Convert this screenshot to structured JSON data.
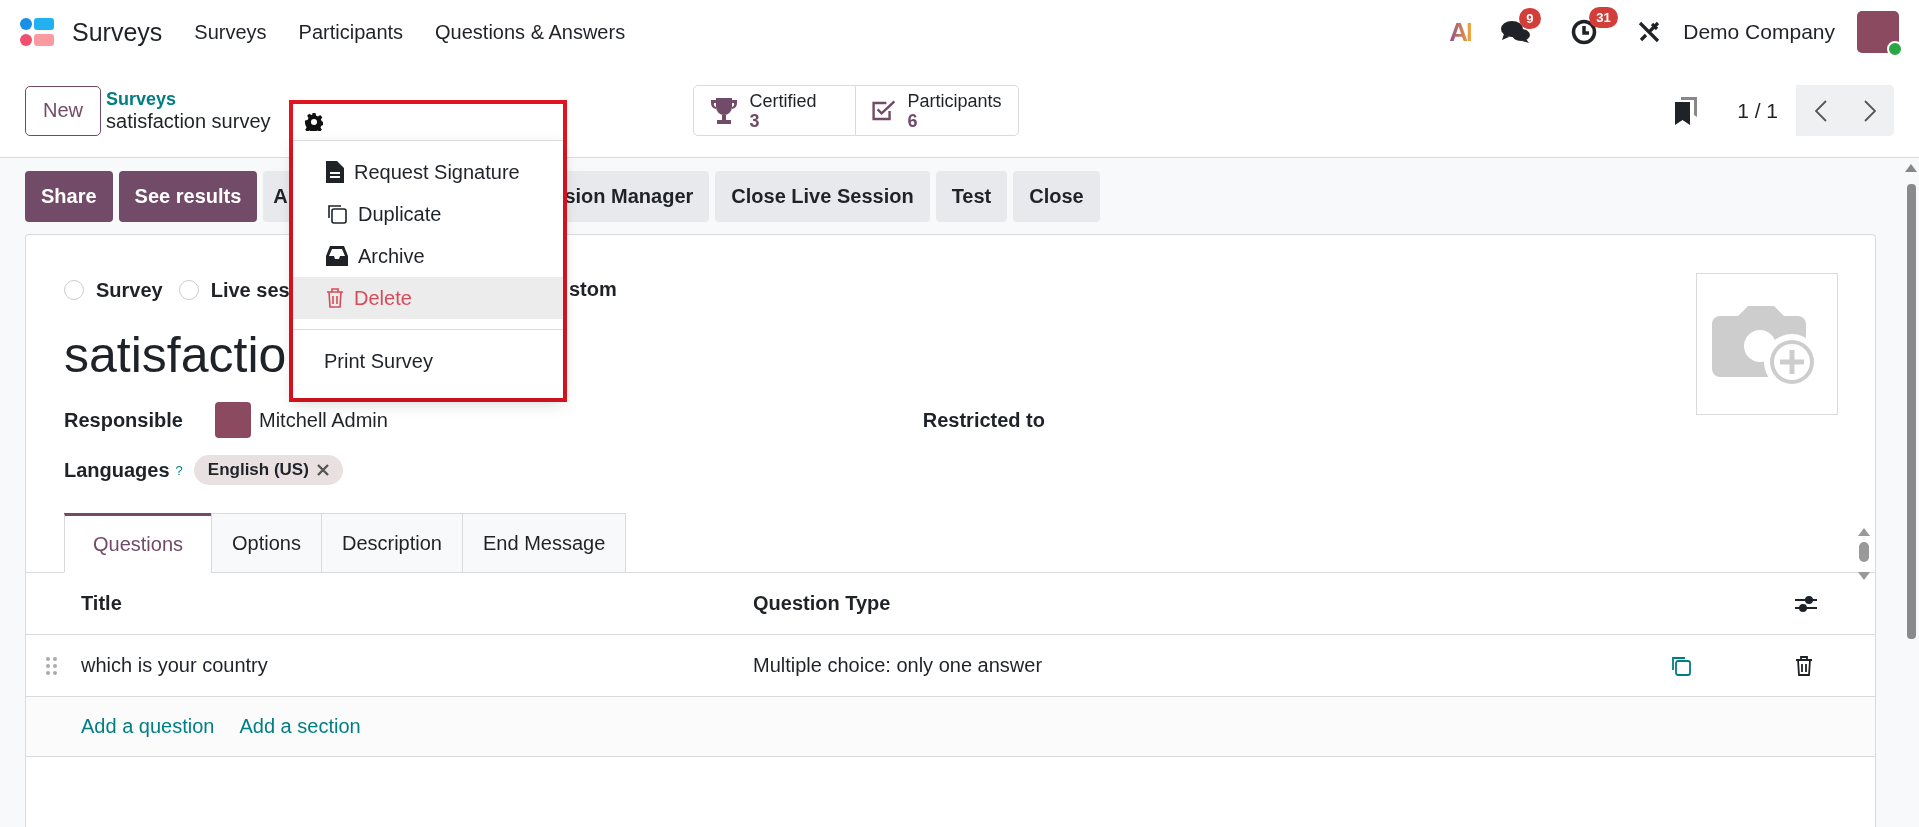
{
  "navbar": {
    "app_name": "Surveys",
    "menu": [
      "Surveys",
      "Participants",
      "Questions & Answers"
    ],
    "ai_label": "AI",
    "messages_badge": "9",
    "activities_badge": "31",
    "company": "Demo Company",
    "user_online": true
  },
  "control_panel": {
    "new_button": "New",
    "breadcrumb": "Surveys",
    "record_name": "satisfaction survey",
    "stat_buttons": [
      {
        "kind": "certified",
        "label": "Certified",
        "value": "3"
      },
      {
        "kind": "participants",
        "label": "Participants",
        "value": "6"
      }
    ],
    "pager": "1 / 1"
  },
  "action_menu": {
    "items": [
      {
        "kind": "signature",
        "label": "Request Signature",
        "highlighted": false
      },
      {
        "kind": "duplicate",
        "label": "Duplicate",
        "highlighted": false
      },
      {
        "kind": "archive",
        "label": "Archive",
        "highlighted": false
      },
      {
        "kind": "delete",
        "label": "Delete",
        "highlighted": true
      }
    ],
    "report_items": [
      "Print Survey"
    ]
  },
  "buttons": [
    {
      "kind": "primary",
      "label": "Share"
    },
    {
      "kind": "primary",
      "label": "See results"
    },
    {
      "kind": "covered-start",
      "label": "A"
    },
    {
      "kind": "covered-end",
      "label": "sion Manager"
    },
    {
      "kind": "secondary",
      "label": "Close Live Session"
    },
    {
      "kind": "secondary",
      "label": "Test"
    },
    {
      "kind": "secondary",
      "label": "Close"
    }
  ],
  "survey_type": [
    {
      "kind": "radio",
      "label": "Survey",
      "selected": false
    },
    {
      "kind": "radio",
      "label": "Live ses",
      "selected": false
    },
    {
      "kind": "covered",
      "label": "stom"
    }
  ],
  "title": "satisfactio",
  "responsible": {
    "label": "Responsible",
    "value": "Mitchell Admin"
  },
  "restricted_to": {
    "label": "Restricted to"
  },
  "languages": {
    "label": "Languages",
    "help": "?",
    "tags": [
      "English (US)"
    ]
  },
  "tabs": [
    {
      "label": "Questions",
      "selected": true
    },
    {
      "label": "Options",
      "selected": false
    },
    {
      "label": "Description",
      "selected": false
    },
    {
      "label": "End Message",
      "selected": false
    }
  ],
  "table": {
    "columns": [
      "Title",
      "Question Type"
    ],
    "rows": [
      {
        "title": "which is your country",
        "question_type": "Multiple choice: only one answer"
      }
    ],
    "add_links": [
      "Add a question",
      "Add a section"
    ]
  }
}
